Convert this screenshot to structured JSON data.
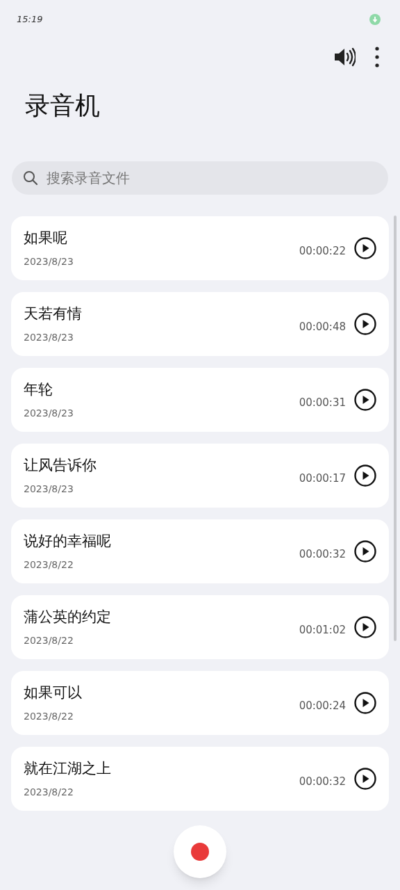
{
  "status_bar": {
    "time": "15:19"
  },
  "title": "录音机",
  "search": {
    "placeholder": "搜索录音文件"
  },
  "recordings": [
    {
      "name": "如果呢",
      "date": "2023/8/23",
      "duration": "00:00:22"
    },
    {
      "name": "天若有情",
      "date": "2023/8/23",
      "duration": "00:00:48"
    },
    {
      "name": "年轮",
      "date": "2023/8/23",
      "duration": "00:00:31"
    },
    {
      "name": "让风告诉你",
      "date": "2023/8/23",
      "duration": "00:00:17"
    },
    {
      "name": "说好的幸福呢",
      "date": "2023/8/22",
      "duration": "00:00:32"
    },
    {
      "name": "蒲公英的约定",
      "date": "2023/8/22",
      "duration": "00:01:02"
    },
    {
      "name": "如果可以",
      "date": "2023/8/22",
      "duration": "00:00:24"
    },
    {
      "name": "就在江湖之上",
      "date": "2023/8/22",
      "duration": "00:00:32"
    }
  ]
}
